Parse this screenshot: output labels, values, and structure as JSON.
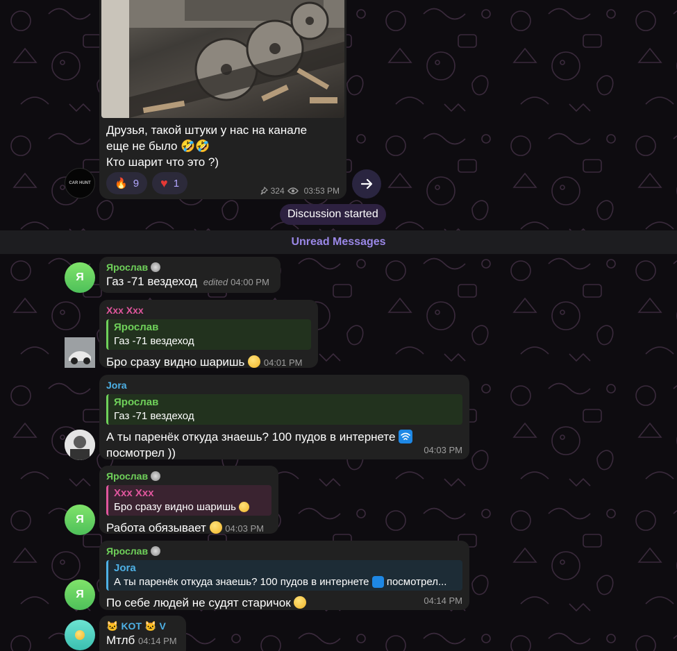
{
  "post": {
    "text": "Друзья, такой штуки у нас на канале\nеще не было 🤣🤣\nКто шарит что это ?)",
    "reactions": [
      {
        "emoji": "🔥",
        "count": "9"
      },
      {
        "emoji": "♥",
        "count": "1"
      }
    ],
    "views": "324",
    "time": "03:53 PM",
    "channel_avatar_text": "CAR HUNT"
  },
  "service": {
    "discussion_started": "Discussion started"
  },
  "unread": {
    "label": "Unread Messages"
  },
  "messages": [
    {
      "sender": "Ярослав",
      "text": "Газ -71 вездеход",
      "edited": "edited",
      "time": "04:00 PM",
      "avatar_initial": "Я"
    },
    {
      "sender": "Xxx Xxx",
      "reply_name": "Ярослав",
      "reply_text": "Газ -71 вездеход",
      "text": "Бро сразу видно шаришь",
      "time": "04:01 PM"
    },
    {
      "sender": "Jora",
      "reply_name": "Ярослав",
      "reply_text": "Газ -71 вездеход",
      "text_line1": "А ты паренёк откуда знаешь? 100 пудов в интернете",
      "text_line2": "посмотрел ))",
      "time": "04:03 PM"
    },
    {
      "sender": "Ярослав",
      "reply_name": "Xxx Xxx",
      "reply_text": "Бро сразу видно шаришь",
      "text": "Работа обязывает",
      "time": "04:03 PM",
      "avatar_initial": "Я"
    },
    {
      "sender": "Ярослав",
      "reply_name": "Jora",
      "reply_text": "А ты паренёк откуда знаешь? 100 пудов в интернете",
      "reply_text_tail": "посмотрел...",
      "text": "По себе людей не судят старичок",
      "time": "04:14 PM",
      "avatar_initial": "Я"
    },
    {
      "sender": "KOT",
      "sender_suffix": "V",
      "text": "Мтлб",
      "time": "04:14 PM"
    }
  ],
  "colors": {
    "green_name": "#6fd15a",
    "pink_name": "#e0569d",
    "blue_name": "#4eb1e6",
    "accent": "#9b88e8"
  }
}
